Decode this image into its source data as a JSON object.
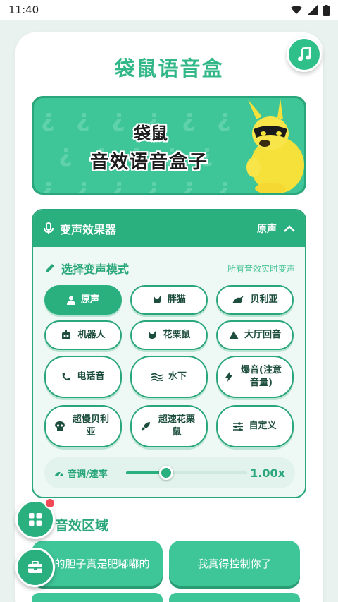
{
  "status_bar": {
    "time": "11:40"
  },
  "app": {
    "title": "袋鼠语音盒"
  },
  "banner": {
    "line1": "袋鼠",
    "line2": "音效语音盒子"
  },
  "panel": {
    "header_title": "变声效果器",
    "current_mode": "原声",
    "subtitle": "选择变声模式",
    "note": "所有音效实时变声",
    "modes": [
      {
        "label": "原声",
        "icon": "person-icon",
        "active": true
      },
      {
        "label": "胖猫",
        "icon": "cat-icon"
      },
      {
        "label": "贝利亚",
        "icon": "dragon-icon"
      },
      {
        "label": "机器人",
        "icon": "robot-icon"
      },
      {
        "label": "花栗鼠",
        "icon": "chipmunk-icon"
      },
      {
        "label": "大厅回音",
        "icon": "triangle-icon"
      },
      {
        "label": "电话音",
        "icon": "phone-icon"
      },
      {
        "label": "水下",
        "icon": "waves-icon"
      },
      {
        "label": "爆音(注意音量)",
        "icon": "bolt-icon"
      },
      {
        "label": "超慢贝利亚",
        "icon": "skull-icon"
      },
      {
        "label": "超速花栗鼠",
        "icon": "rocket-icon"
      },
      {
        "label": "自定义",
        "icon": "sliders-icon"
      }
    ],
    "slider_label": "音调/速率",
    "slider_value": "1.00x",
    "slider_fraction": 0.33
  },
  "sound_area": {
    "title": "音效区域",
    "items": [
      "的胆子真是肥嘟嘟的",
      "我真得控制你了"
    ]
  },
  "colors": {
    "primary": "#2ab07f",
    "title": "#32b888",
    "badge": "#f04a57"
  }
}
